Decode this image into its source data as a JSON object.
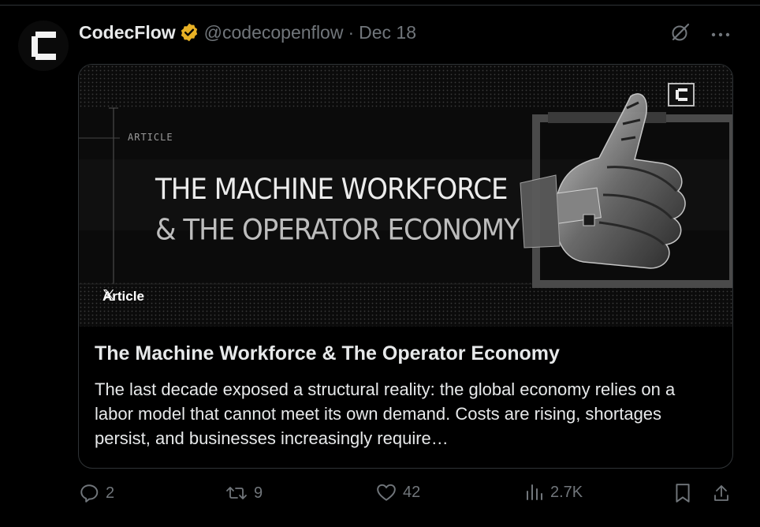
{
  "tweet": {
    "display_name": "CodecFlow",
    "handle": "@codecopenflow",
    "separator": "·",
    "date": "Dec 18",
    "verified_color": "#e8b125"
  },
  "card": {
    "banner_label": "ARTICLE",
    "banner_title_line1": "THE MACHINE WORKFORCE",
    "banner_title_line2": "& THE OPERATOR ECONOMY",
    "badge_label": "Article",
    "title": "The Machine Workforce & The Operator Economy",
    "description": "The last decade exposed a structural reality: the global economy relies on a labor model that cannot meet its own demand. Costs are rising, shortages persist, and businesses increasingly require…"
  },
  "actions": {
    "replies": "2",
    "reposts": "9",
    "likes": "42",
    "views": "2.7K"
  },
  "icons": [
    "grok-icon",
    "more-icon",
    "verified-badge-icon",
    "x-logo-icon",
    "reply-icon",
    "repost-icon",
    "like-icon",
    "views-icon",
    "bookmark-icon",
    "share-icon"
  ],
  "colors": {
    "text": "#e7e9ea",
    "muted": "#71767b",
    "border": "#2f3336",
    "background": "#000000"
  }
}
